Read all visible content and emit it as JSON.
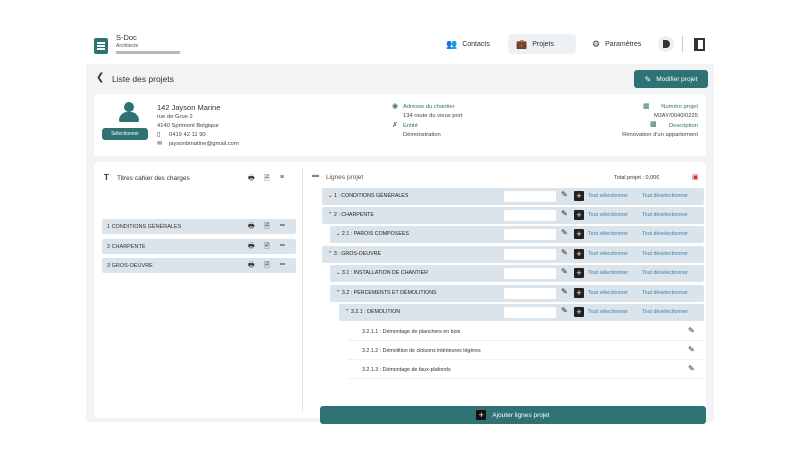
{
  "brand": {
    "name": "S-Doc",
    "role": "Architecte",
    "logo_icon": "document-icon"
  },
  "nav": {
    "contacts": "Contacts",
    "projets": "Projets",
    "parametres": "Paramètres"
  },
  "header": {
    "title": "Liste des projets",
    "edit_button": "Modifier projet"
  },
  "client": {
    "select_button": "Sélectionner",
    "name": "142  Jayson  Marine",
    "street": "rue de Grue 2",
    "city": "4140  Sprimont  Belgique",
    "phone": "0419 42 11 90",
    "email": "jaysonbmatine@gmail.com"
  },
  "site": {
    "address_label": "Adresse du chantier",
    "address_value": "134 route du vieux port",
    "entity_label": "Entité",
    "entity_value": "Démonstration"
  },
  "project": {
    "number_label": "Numéro projet",
    "number_value": "MJAY/0040/0225",
    "description_label": "Description",
    "description_value": "Rénovation d'un appartement"
  },
  "charges": {
    "title": "Titres cahier des charges",
    "items": [
      {
        "label": "1  CONDITIONS GÉNÉRALES"
      },
      {
        "label": "2  CHARPENTE"
      },
      {
        "label": "3  GROS-OEUVRE"
      }
    ]
  },
  "lines": {
    "title": "Lignes projet",
    "total": "Total projet : 0,00€",
    "select_all": "Tout sélectionner",
    "deselect_all": "Tout déselectionner",
    "rows": [
      {
        "label": "⌄ 1 : CONDITIONS GÉNÉRALES"
      },
      {
        "label": "⌃ 2 : CHARPENTE"
      },
      {
        "label": "⌄ 2.1 : PAROIS COMPOSEES"
      },
      {
        "label": "⌃ 3 : GROS-OEUVRE"
      },
      {
        "label": "⌄ 3.1 : INSTALLATION DE CHANTIER"
      },
      {
        "label": "⌃ 3.2 : PERCEMENTS ET DÉMOLITIONS"
      },
      {
        "label": "⌃ 3.2.1 : DEMOLITION"
      }
    ],
    "tasks": [
      {
        "label": "3.2.1.1 : Démontage de planchers en bois"
      },
      {
        "label": "3.2.1.2 : Démolition de cloisons intérieures légères"
      },
      {
        "label": "3.2.1.3 : Démontage de faux-plafonds"
      }
    ],
    "add_button": "Ajouter lignes projet"
  },
  "colors": {
    "accent": "#2e7273",
    "row_bg": "#dbe4ea",
    "link": "#3b7fb0",
    "danger": "#d32f2f"
  }
}
